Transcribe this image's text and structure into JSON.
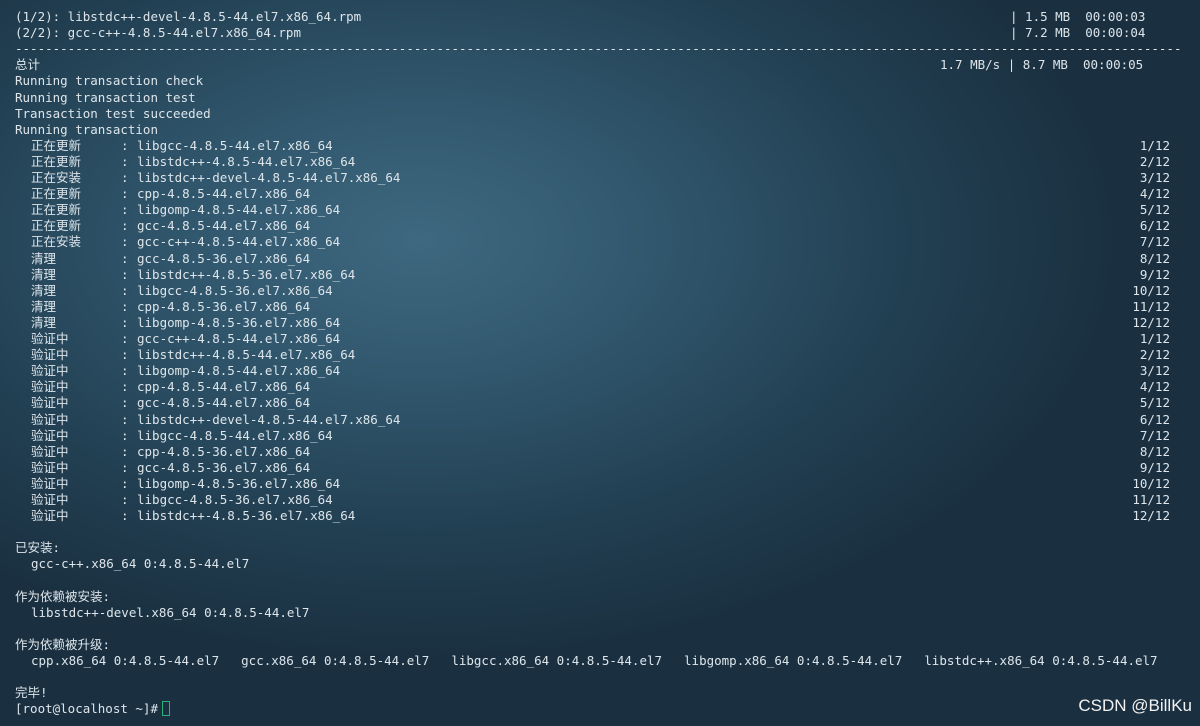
{
  "downloads": [
    {
      "name": "(1/2): libstdc++-devel-4.8.5-44.el7.x86_64.rpm",
      "size": "| 1.5 MB  00:00:03"
    },
    {
      "name": "(2/2): gcc-c++-4.8.5-44.el7.x86_64.rpm",
      "size": "| 7.2 MB  00:00:04"
    }
  ],
  "separator": "--------------------------------------------------------------------------------------------------------------------------------------------------------------",
  "total": {
    "label": "总计",
    "stats": "1.7 MB/s | 8.7 MB  00:00:05"
  },
  "status_lines": [
    "Running transaction check",
    "Running transaction test",
    "Transaction test succeeded",
    "Running transaction"
  ],
  "steps": [
    {
      "action": "正在更新",
      "pkg": "libgcc-4.8.5-44.el7.x86_64",
      "count": "1/12"
    },
    {
      "action": "正在更新",
      "pkg": "libstdc++-4.8.5-44.el7.x86_64",
      "count": "2/12"
    },
    {
      "action": "正在安装",
      "pkg": "libstdc++-devel-4.8.5-44.el7.x86_64",
      "count": "3/12"
    },
    {
      "action": "正在更新",
      "pkg": "cpp-4.8.5-44.el7.x86_64",
      "count": "4/12"
    },
    {
      "action": "正在更新",
      "pkg": "libgomp-4.8.5-44.el7.x86_64",
      "count": "5/12"
    },
    {
      "action": "正在更新",
      "pkg": "gcc-4.8.5-44.el7.x86_64",
      "count": "6/12"
    },
    {
      "action": "正在安装",
      "pkg": "gcc-c++-4.8.5-44.el7.x86_64",
      "count": "7/12"
    },
    {
      "action": "清理",
      "pkg": "gcc-4.8.5-36.el7.x86_64",
      "count": "8/12"
    },
    {
      "action": "清理",
      "pkg": "libstdc++-4.8.5-36.el7.x86_64",
      "count": "9/12"
    },
    {
      "action": "清理",
      "pkg": "libgcc-4.8.5-36.el7.x86_64",
      "count": "10/12"
    },
    {
      "action": "清理",
      "pkg": "cpp-4.8.5-36.el7.x86_64",
      "count": "11/12"
    },
    {
      "action": "清理",
      "pkg": "libgomp-4.8.5-36.el7.x86_64",
      "count": "12/12"
    },
    {
      "action": "验证中",
      "pkg": "gcc-c++-4.8.5-44.el7.x86_64",
      "count": "1/12"
    },
    {
      "action": "验证中",
      "pkg": "libstdc++-4.8.5-44.el7.x86_64",
      "count": "2/12"
    },
    {
      "action": "验证中",
      "pkg": "libgomp-4.8.5-44.el7.x86_64",
      "count": "3/12"
    },
    {
      "action": "验证中",
      "pkg": "cpp-4.8.5-44.el7.x86_64",
      "count": "4/12"
    },
    {
      "action": "验证中",
      "pkg": "gcc-4.8.5-44.el7.x86_64",
      "count": "5/12"
    },
    {
      "action": "验证中",
      "pkg": "libstdc++-devel-4.8.5-44.el7.x86_64",
      "count": "6/12"
    },
    {
      "action": "验证中",
      "pkg": "libgcc-4.8.5-44.el7.x86_64",
      "count": "7/12"
    },
    {
      "action": "验证中",
      "pkg": "cpp-4.8.5-36.el7.x86_64",
      "count": "8/12"
    },
    {
      "action": "验证中",
      "pkg": "gcc-4.8.5-36.el7.x86_64",
      "count": "9/12"
    },
    {
      "action": "验证中",
      "pkg": "libgomp-4.8.5-36.el7.x86_64",
      "count": "10/12"
    },
    {
      "action": "验证中",
      "pkg": "libgcc-4.8.5-36.el7.x86_64",
      "count": "11/12"
    },
    {
      "action": "验证中",
      "pkg": "libstdc++-4.8.5-36.el7.x86_64",
      "count": "12/12"
    }
  ],
  "installed": {
    "label": "已安装:",
    "items": [
      "gcc-c++.x86_64 0:4.8.5-44.el7"
    ]
  },
  "dep_installed": {
    "label": "作为依赖被安装:",
    "items": [
      "libstdc++-devel.x86_64 0:4.8.5-44.el7"
    ]
  },
  "dep_upgraded": {
    "label": "作为依赖被升级:",
    "items": [
      "cpp.x86_64 0:4.8.5-44.el7",
      "gcc.x86_64 0:4.8.5-44.el7",
      "libgcc.x86_64 0:4.8.5-44.el7",
      "libgomp.x86_64 0:4.8.5-44.el7",
      "libstdc++.x86_64 0:4.8.5-44.el7"
    ]
  },
  "complete": "完毕!",
  "prompt": "[root@localhost ~]#",
  "watermark": "CSDN @BillKu",
  "colors": {
    "text": "#dde5ea",
    "cursor": "#2bb07a"
  }
}
